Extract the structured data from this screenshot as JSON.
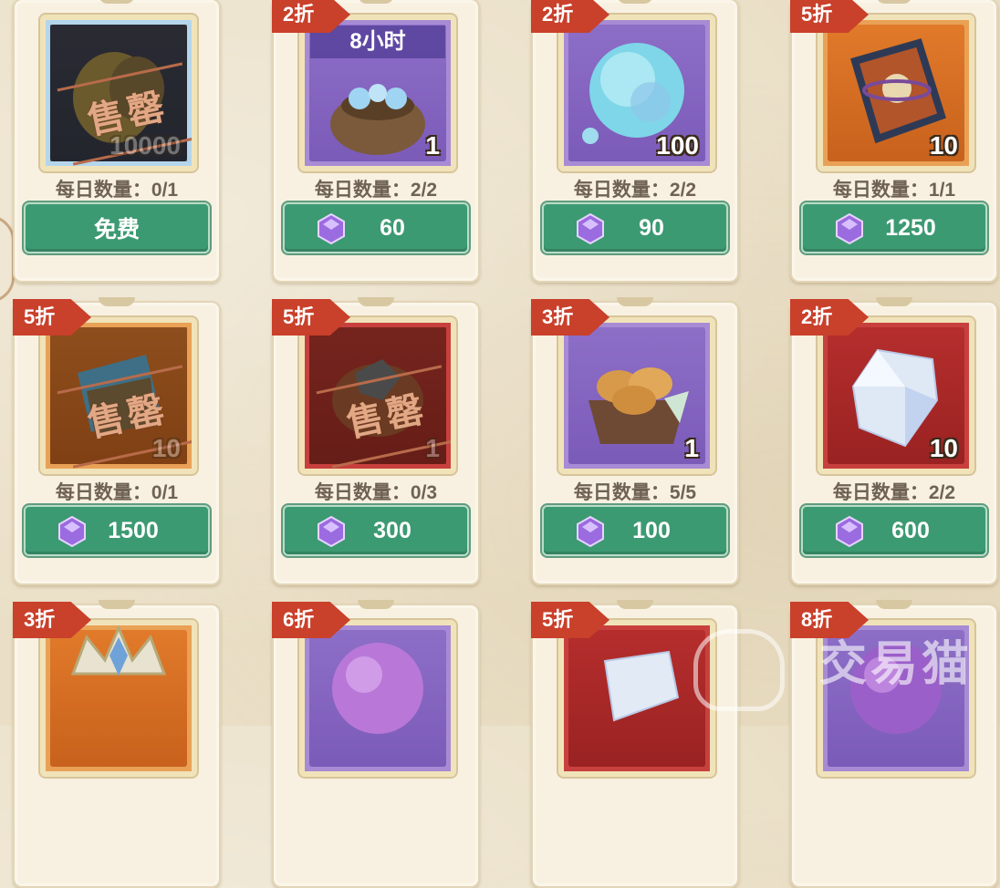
{
  "shop": {
    "cards": [
      {
        "discount": "",
        "frame": "blue",
        "qty": "10000",
        "timer": "",
        "sold_out": "售罄",
        "daily_label": "每日数量：",
        "daily": "0/1",
        "price": "免费",
        "free": true,
        "art": "gold-sack"
      },
      {
        "discount": "2折",
        "frame": "purple",
        "qty": "1",
        "timer": "8小时",
        "sold_out": "",
        "daily_label": "每日数量：",
        "daily": "2/2",
        "price": "60",
        "free": false,
        "art": "potion-bag"
      },
      {
        "discount": "2折",
        "frame": "purple",
        "qty": "100",
        "timer": "",
        "sold_out": "",
        "daily_label": "每日数量：",
        "daily": "2/2",
        "price": "90",
        "free": false,
        "art": "bubble-orb"
      },
      {
        "discount": "5折",
        "frame": "orange",
        "qty": "10",
        "timer": "",
        "sold_out": "",
        "daily_label": "每日数量：",
        "daily": "1/1",
        "price": "1250",
        "free": false,
        "art": "book"
      },
      {
        "discount": "5折",
        "frame": "orange",
        "qty": "10",
        "timer": "",
        "sold_out": "售罄",
        "daily_label": "每日数量：",
        "daily": "0/1",
        "price": "1500",
        "free": false,
        "art": "scroll-bundle"
      },
      {
        "discount": "5折",
        "frame": "red",
        "qty": "1",
        "timer": "",
        "sold_out": "售罄",
        "daily_label": "每日数量：",
        "daily": "0/3",
        "price": "300",
        "free": false,
        "art": "ore-sack"
      },
      {
        "discount": "3折",
        "frame": "purple",
        "qty": "1",
        "timer": "",
        "sold_out": "",
        "daily_label": "每日数量：",
        "daily": "5/5",
        "price": "100",
        "free": false,
        "art": "bread-basket"
      },
      {
        "discount": "2折",
        "frame": "red",
        "qty": "10",
        "timer": "",
        "sold_out": "",
        "daily_label": "每日数量：",
        "daily": "2/2",
        "price": "600",
        "free": false,
        "art": "crystal"
      },
      {
        "discount": "3折",
        "frame": "orange",
        "qty": "",
        "timer": "",
        "sold_out": "",
        "daily_label": "",
        "daily": "",
        "price": "",
        "free": false,
        "art": "crown"
      },
      {
        "discount": "6折",
        "frame": "purple",
        "qty": "",
        "timer": "",
        "sold_out": "",
        "daily_label": "",
        "daily": "",
        "price": "",
        "free": false,
        "art": "purple-orb"
      },
      {
        "discount": "5折",
        "frame": "red",
        "qty": "",
        "timer": "",
        "sold_out": "",
        "daily_label": "",
        "daily": "",
        "price": "",
        "free": false,
        "art": "crystal"
      },
      {
        "discount": "8折",
        "frame": "purple",
        "qty": "",
        "timer": "",
        "sold_out": "",
        "daily_label": "",
        "daily": "",
        "price": "",
        "free": false,
        "art": "purple-orb"
      }
    ],
    "currency_icon": "purple-gem-icon",
    "watermark": "交易猫",
    "colors": {
      "button": "#3c9a72",
      "discount": "#c9402b",
      "background": "#eadfc6"
    }
  }
}
